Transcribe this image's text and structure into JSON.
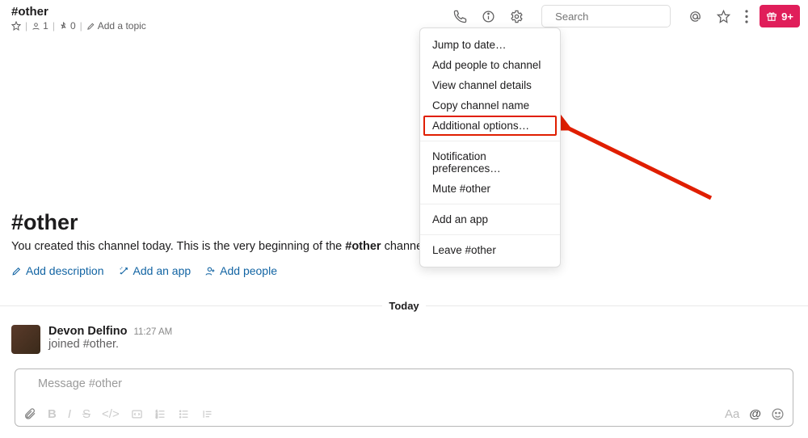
{
  "header": {
    "channel_name": "#other",
    "meta": {
      "member_count": "1",
      "pin_count": "0",
      "add_topic": "Add a topic"
    },
    "search_placeholder": "Search",
    "gift_text": "9+"
  },
  "dropdown": {
    "items": [
      "Jump to date…",
      "Add people to channel",
      "View channel details",
      "Copy channel name",
      "Additional options…"
    ],
    "group2": [
      "Notification preferences…",
      "Mute #other"
    ],
    "group3": [
      "Add an app"
    ],
    "group4": [
      "Leave #other"
    ]
  },
  "intro": {
    "title": "#other",
    "text_prefix": "You created this channel today. This is the very beginning of the ",
    "text_bold": "#other",
    "text_suffix": " channel.",
    "links": {
      "desc": "Add description",
      "app": "Add an app",
      "people": "Add people"
    }
  },
  "divider_label": "Today",
  "message": {
    "name": "Devon Delfino",
    "time": "11:27 AM",
    "text": "joined #other."
  },
  "composer": {
    "placeholder": "Message #other"
  }
}
